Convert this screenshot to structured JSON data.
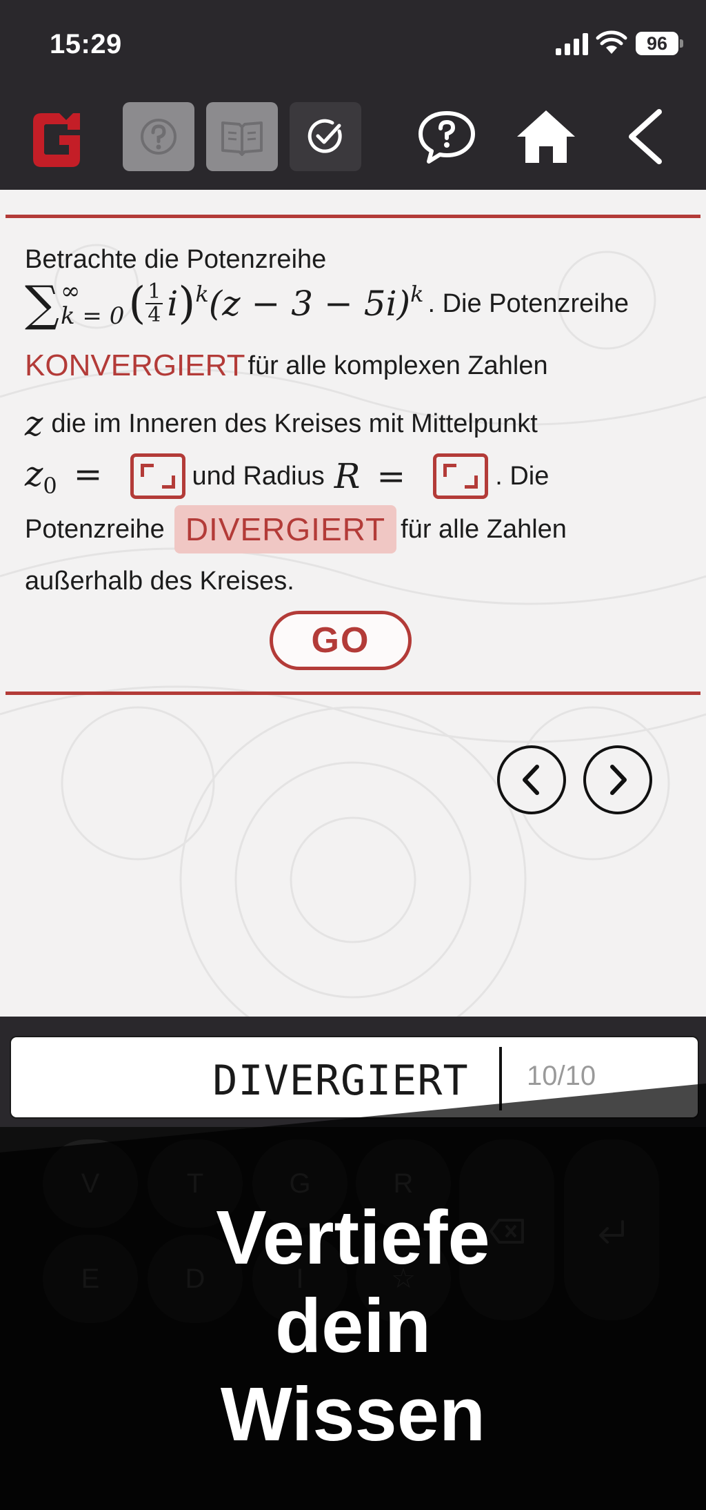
{
  "status_bar": {
    "time": "15:29",
    "battery": "96"
  },
  "toolbar": {
    "logo_icon": "app-logo",
    "buttons": [
      {
        "name": "help-icon",
        "state": "disabled"
      },
      {
        "name": "book-icon",
        "state": "disabled"
      },
      {
        "name": "checkmark-icon",
        "state": "active"
      }
    ],
    "right_icons": [
      "chat-question-icon",
      "home-icon",
      "back-chevron-icon"
    ]
  },
  "exercise": {
    "line1": "Betrachte die Potenzreihe",
    "formula": {
      "sum_symbol": "∑",
      "upper": "∞",
      "lower": "k = 0",
      "frac_num": "1",
      "frac_den": "4",
      "coeff_var": "i",
      "exp1": "k",
      "binomial": "(z − 3 − 5i)",
      "exp2": "k"
    },
    "after_formula": ". Die Potenzreihe",
    "answer1": "KONVERGIERT",
    "line3_rest": "für alle komplexen Zahlen",
    "z_var": "z",
    "line4_rest": "die im Inneren des Kreises mit Mittelpunkt",
    "z0_label": "z",
    "z0_sub": "0",
    "equals": "=",
    "radius_text": "und Radius",
    "r_label": "R",
    "after_radius": ". Die",
    "line6_start": "Potenzreihe",
    "answer2": "DIVERGIERT",
    "line6_rest": "für alle Zahlen",
    "line7": "außerhalb des Kreises.",
    "go_label": "GO"
  },
  "navigation": {
    "prev_icon": "chevron-left-icon",
    "next_icon": "chevron-right-icon"
  },
  "input": {
    "value": "DIVERGIERT",
    "counter": "10/10"
  },
  "keyboard": {
    "keys": [
      "V",
      "T",
      "G",
      "R",
      "E",
      "D",
      "I",
      "☆"
    ],
    "backspace_icon": "backspace-icon",
    "enter_icon": "enter-icon"
  },
  "overlay": {
    "line1": "Vertiefe",
    "line2": "dein",
    "line3": "Wissen"
  },
  "colors": {
    "accent": "#b33b38",
    "dark": "#2a282c",
    "highlight": "#f0c7c4"
  }
}
